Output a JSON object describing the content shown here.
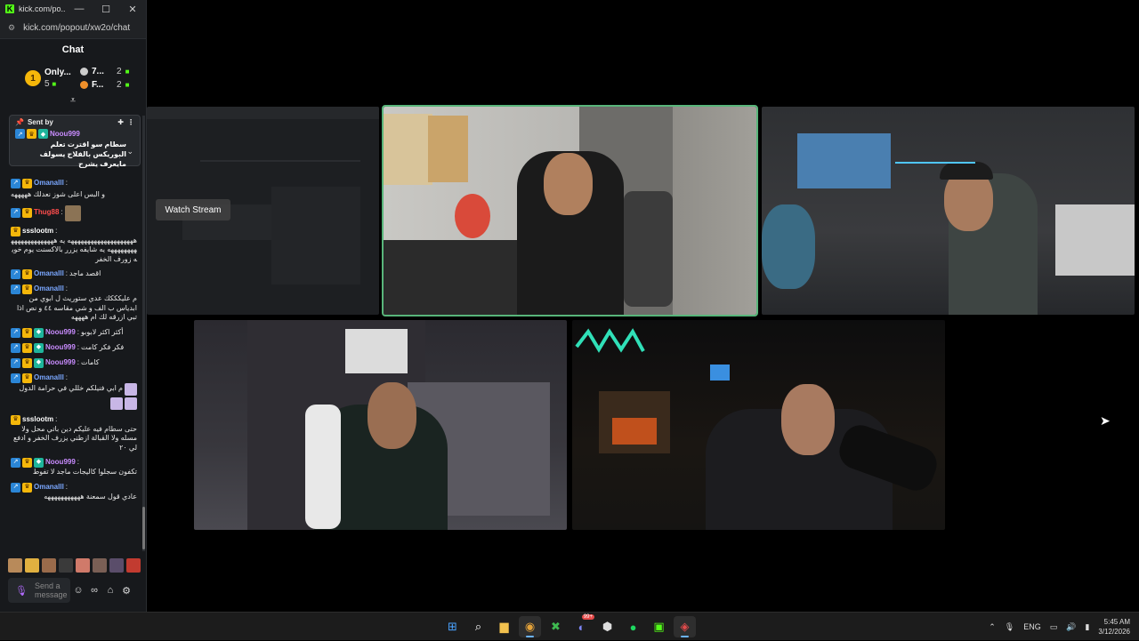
{
  "window": {
    "title": "kick.com/po...",
    "url": "kick.com/popout/xw2o/chat",
    "min_icon": "minimize-icon",
    "max_icon": "maximize-icon",
    "close_icon": "close-icon"
  },
  "chat": {
    "header": "Chat",
    "leaderboard": {
      "rank": "1",
      "top_name": "Only...",
      "top_count": "5",
      "side": [
        {
          "name": "7...",
          "count": "2"
        },
        {
          "name": "F...",
          "count": "2"
        }
      ]
    },
    "pinned": {
      "label": "Sent by",
      "user": "Noou999",
      "text": "سطام سو اقترت تعلم البوريكس بالفلاج يسولف مايعرف يشرح"
    },
    "messages": [
      {
        "user": "Omanalll",
        "color": "blue",
        "text": "و البس اعلى شوز نعدلك هههههه"
      },
      {
        "user": "Thug88",
        "color": "red",
        "text": ""
      },
      {
        "user": "ssslootm",
        "color": "white",
        "text": "ههههههههههههههههههههه يه ههههههههههههههههههههههه يه شايفه يزرر بالاكسنت يوم خويه زورف الخفر"
      },
      {
        "user": "Omanalll",
        "color": "blue",
        "text": "اقصد ماجد"
      },
      {
        "user": "Omanalll",
        "color": "blue",
        "text": "م عليكككك عدي ستوريث ل ابوي من ابدياس ب الف و شي مقاسه ٤٤ و نص اذا تبي ازرقه لك ام ههههه"
      },
      {
        "user": "Noou999",
        "color": "pink",
        "text": "أكثر اكثر لابوبو"
      },
      {
        "user": "Noou999",
        "color": "pink",
        "text": "فكر فكر كامت"
      },
      {
        "user": "Noou999",
        "color": "pink",
        "text": "كامات"
      },
      {
        "user": "Omanalll",
        "color": "blue",
        "text": "م ابي فنيلكم خللي في حرامة الدول"
      },
      {
        "user": "ssslootm",
        "color": "white",
        "text": "حتى سطام فيه عليكم دين باتي محل ولا مسله ولا القبالة ازطني يزرف الخفر و ادفع لي ٢٠"
      },
      {
        "user": "Noou999",
        "color": "pink",
        "text": "تكفون سجلوا كاليجات ماجد لا تفوط"
      },
      {
        "user": "Omanalll",
        "color": "blue",
        "text": "عادي قول سمعنة هههههههههههه"
      }
    ],
    "input_placeholder": "Send a message"
  },
  "streams": {
    "watch_label": "Watch Stream"
  },
  "taskbar": {
    "apps": [
      "windows-start-icon",
      "search-icon",
      "file-explorer-icon",
      "chrome-icon",
      "xbox-icon",
      "discord-icon",
      "obs-icon",
      "spotify-icon",
      "kick-app-icon",
      "steam-icon"
    ],
    "discord_badge": "99+",
    "language": "ENG",
    "time": "5:45 AM",
    "date": "3/12/2026"
  }
}
